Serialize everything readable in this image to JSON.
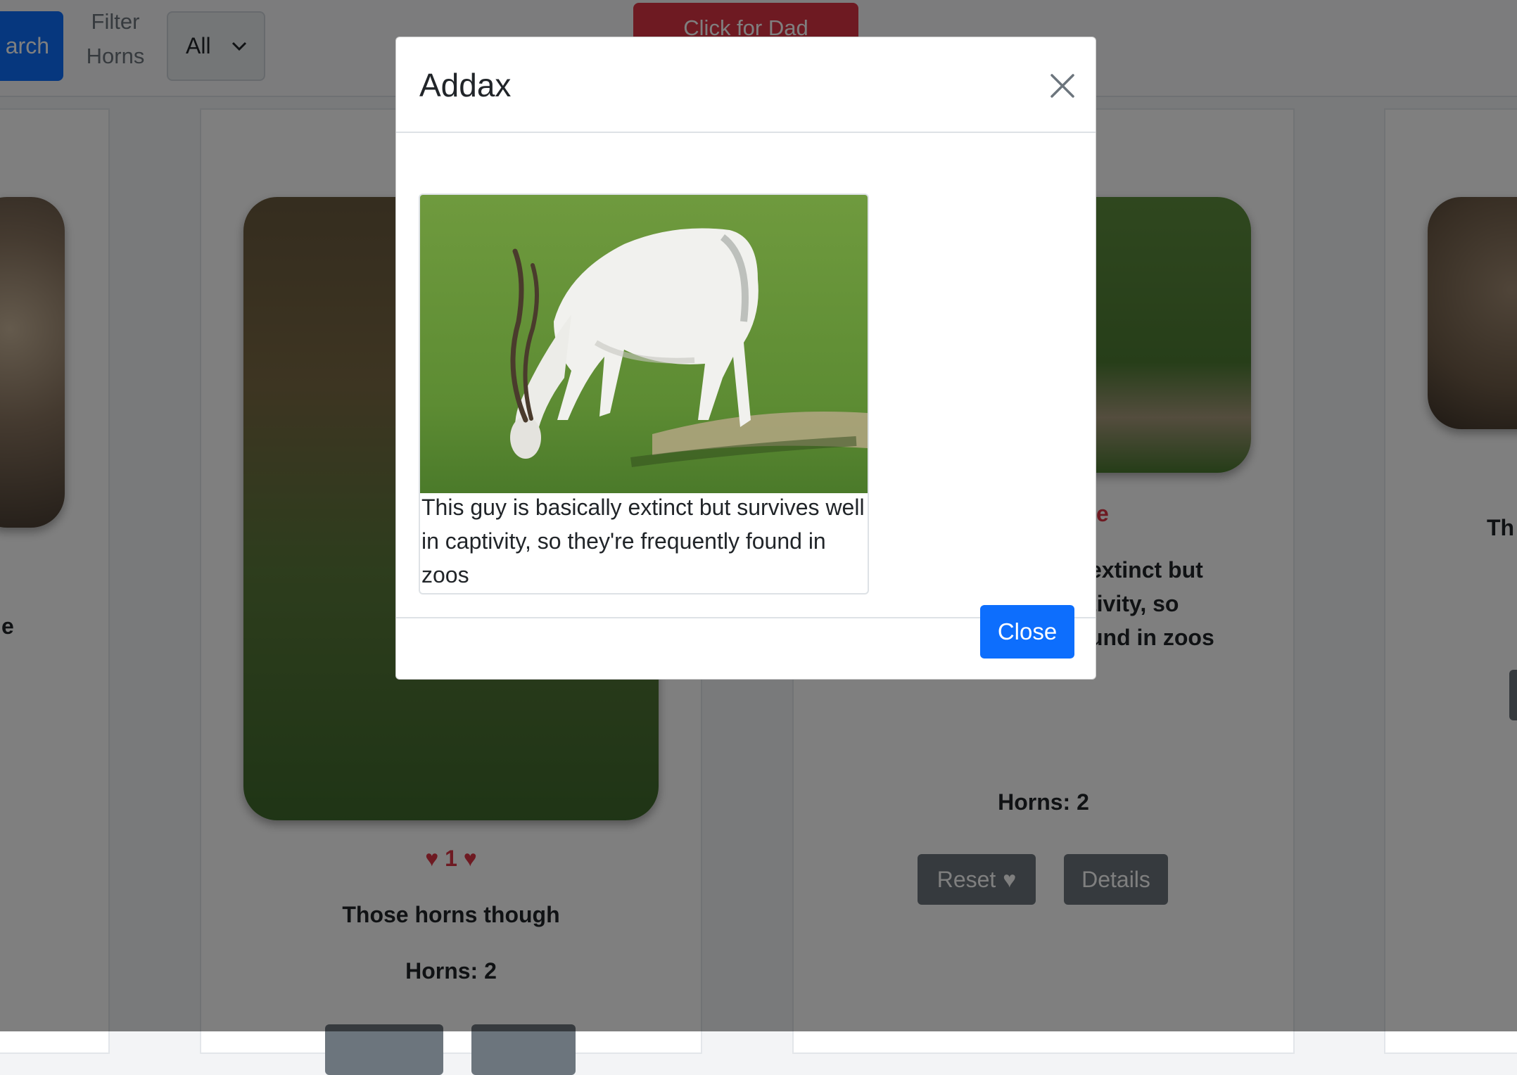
{
  "navbar": {
    "search_label": "arch",
    "filter_label": "Filter Horns",
    "filter_value": "All",
    "dad_button_label": "Click for Dad"
  },
  "cards": [
    {
      "id": "left-partial",
      "title_fragment": "e"
    },
    {
      "id": "center",
      "likes": "1",
      "description": "Those horns though",
      "horns": "Horns: 2"
    },
    {
      "id": "right",
      "title_fragment": "e",
      "description_fragment": "extinct but\ntivity, so\nund in zoos",
      "horns": "Horns: 2",
      "reset_label": "Reset",
      "details_label": "Details"
    },
    {
      "id": "far-right-partial",
      "title_fragment": "Th"
    }
  ],
  "modal": {
    "title": "Addax",
    "caption": "This guy is basically extinct but survives well in captivity, so they're frequently found in zoos",
    "close_label": "Close"
  },
  "colors": {
    "primary": "#0d6efd",
    "danger": "#dc3545",
    "secondary": "#6c757d"
  }
}
